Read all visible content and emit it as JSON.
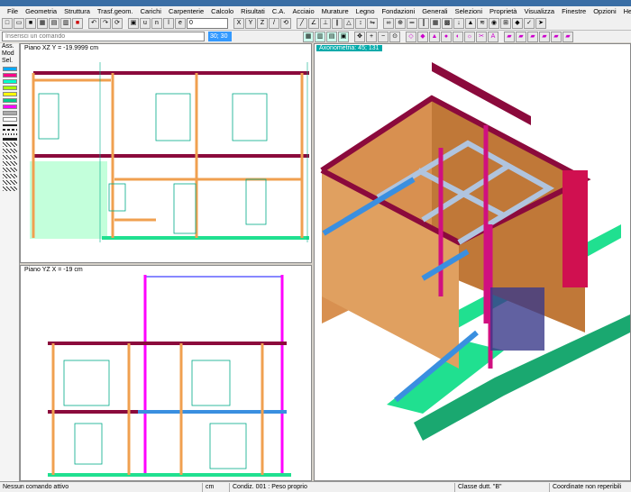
{
  "menu": [
    "File",
    "Geometria",
    "Struttura",
    "Trasf.geom.",
    "Carichi",
    "Carpenterie",
    "Calcolo",
    "Risultati",
    "C.A.",
    "Acciaio",
    "Murature",
    "Legno",
    "Fondazioni",
    "Generali",
    "Selezioni",
    "Proprietà",
    "Visualizza",
    "Finestre",
    "Opzioni",
    "Help"
  ],
  "toolbar": {
    "value_field": "0"
  },
  "command": {
    "placeholder": "Inserisci un comando",
    "value": "30; 30"
  },
  "palette": {
    "labels": [
      "Ass.",
      "Mod",
      "Sel."
    ],
    "colors": [
      "#00aaff",
      "#ff0088",
      "#00ffcc",
      "#aaff00",
      "#ffff00",
      "#00cc88",
      "#ff00ff",
      "#aaaaaa",
      "#ffffff"
    ]
  },
  "views": {
    "xz_label": "Piano XZ   Y = -19.9999 cm",
    "yz_label": "Piano YZ   X = -19 cm",
    "axo_label": "Axonometria:  45; 131"
  },
  "status": {
    "cells": [
      "Nessun comando attivo",
      "cm",
      "Condiz. 001 : Peso proprio",
      "Classe dutt. \"B\"",
      "Coordinate non reperibili"
    ]
  },
  "colors": {
    "beam": "#8b0a3c",
    "column": "#f0a050",
    "wall": "#d89050",
    "found": "#20e090",
    "steel": "#b0c4de",
    "blue": "#3a8fe0",
    "pink": "#ff00ff"
  }
}
